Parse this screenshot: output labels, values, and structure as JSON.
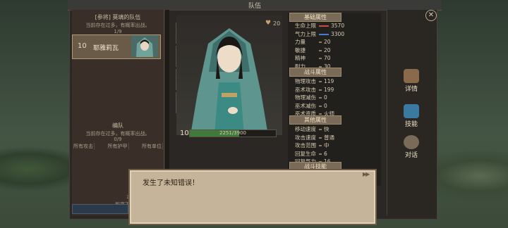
{
  "window": {
    "title": "队伍"
  },
  "left_panel": {
    "header": "[参将] 莫璃的队伍",
    "subtitle": "当前存在过多，有概率出战。",
    "count": "1/9",
    "member": {
      "level": "10",
      "name": "耶雅莉瓦"
    },
    "formation_title": "编队",
    "formation_subtitle": "当前存在过多，有概率出战。",
    "formation_count": "0/9",
    "filters": [
      "所有攻击",
      "所有护甲",
      "所有单位"
    ],
    "footer_line1": "可用招募次数 2",
    "footer_line2": "距离下次招募刷新 ..."
  },
  "character": {
    "level": "10",
    "xp_text": "2251/3900",
    "xp_fraction": 0.577,
    "affection": "20"
  },
  "stats": {
    "basic": {
      "title": "基础属性",
      "rows": [
        {
          "label": "生命上限",
          "value": "3570",
          "bar_color": "#d04a3a"
        },
        {
          "label": "气力上限",
          "value": "3300",
          "bar_color": "#4a7ad0"
        },
        {
          "label": "力量",
          "value": "20"
        },
        {
          "label": "敏捷",
          "value": "20"
        },
        {
          "label": "精神",
          "value": "70"
        },
        {
          "label": "耐力",
          "value": "30"
        }
      ]
    },
    "combat": {
      "title": "战斗属性",
      "rows": [
        {
          "label": "物理攻击",
          "value": "119"
        },
        {
          "label": "巫术攻击",
          "value": "199"
        },
        {
          "label": "物理减伤",
          "value": "0"
        },
        {
          "label": "巫术减伤",
          "value": "0"
        },
        {
          "label": "巫术资质",
          "value": "火师"
        }
      ]
    },
    "other": {
      "title": "其他属性",
      "rows": [
        {
          "label": "移动速度",
          "value": "快"
        },
        {
          "label": "攻击速度",
          "value": "普通"
        },
        {
          "label": "攻击范围",
          "value": "中"
        },
        {
          "label": "回复生命",
          "value": "6"
        },
        {
          "label": "回复气力",
          "value": "16"
        }
      ]
    },
    "next_title": "战斗技能"
  },
  "side_buttons": [
    {
      "label": "详情",
      "icon": "scroll-icon"
    },
    {
      "label": "技能",
      "icon": "flame-icon"
    },
    {
      "label": "对话",
      "icon": "chat-icon"
    }
  ],
  "dialog": {
    "text": "发生了未知错误！",
    "skip": "▶▶"
  },
  "colors": {
    "accent": "#b09a72",
    "hp": "#d04a3a",
    "mp": "#4a7ad0",
    "xp": "#3f7a3a"
  }
}
